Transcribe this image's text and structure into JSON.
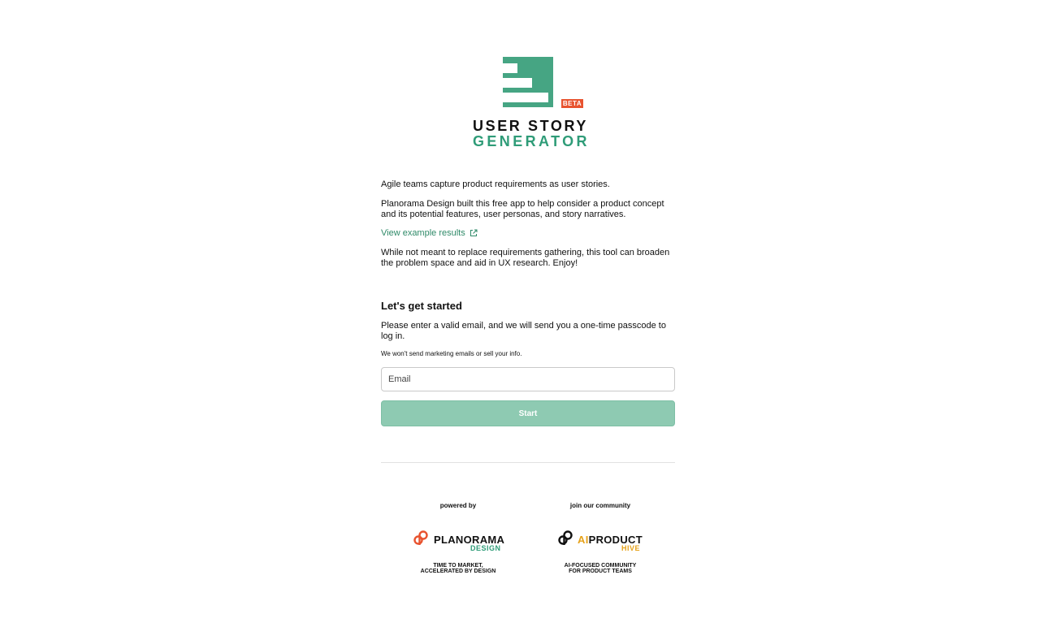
{
  "logo": {
    "beta": "BETA",
    "title_line1": "USER STORY",
    "title_line2": "GENERATOR"
  },
  "intro": {
    "p1": "Agile teams capture product requirements as user stories.",
    "p2": "Planorama Design built this free app to help consider a product concept and its potential features, user personas, and story narratives.",
    "link_label": "View example results",
    "p3": "While not meant to replace requirements gathering, this tool can broaden the problem space and aid in UX research. Enjoy!"
  },
  "signup": {
    "heading": "Let's get started",
    "instructions": "Please enter a valid email, and we will send you a one-time passcode to log in.",
    "fine_print": "We won't send marketing emails or sell your info.",
    "email_placeholder": "Email",
    "email_value": "",
    "start_label": "Start"
  },
  "footer": {
    "powered_by": {
      "label": "powered by",
      "brand_name": "PLANORAMA",
      "brand_sub": "DESIGN",
      "tagline_line1": "TIME TO MARKET,",
      "tagline_line2": "ACCELERATED BY DESIGN"
    },
    "community": {
      "label": "join our community",
      "brand_name_prefix": "AI",
      "brand_name_rest": "PRODUCT",
      "brand_sub": "HIVE",
      "tagline_line1": "AI-FOCUSED COMMUNITY",
      "tagline_line2": "FOR PRODUCT TEAMS"
    }
  },
  "colors": {
    "brand_green": "#46a583",
    "accent_orange": "#e8532f",
    "hive_yellow": "#e6a21a",
    "button_disabled": "#8ecab2",
    "link": "#2f8a68"
  }
}
